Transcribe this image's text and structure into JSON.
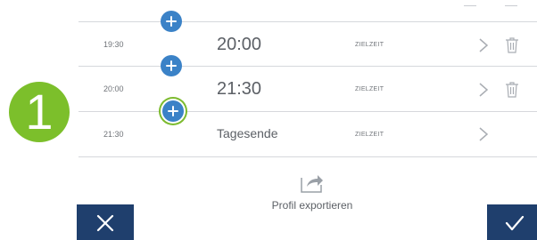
{
  "rows": [
    {
      "start": "19:30",
      "end": "20:00",
      "type": "ZIELZEIT"
    },
    {
      "start": "20:00",
      "end": "21:30",
      "type": "ZIELZEIT"
    },
    {
      "start": "21:30",
      "end": "Tagesende",
      "type": "ZIELZEIT"
    }
  ],
  "step_number": "1",
  "export_label": "Profil exportieren",
  "icons": {
    "add": "plus-icon",
    "chevron": "chevron-right-icon",
    "delete": "trash-icon",
    "export": "share-export-icon",
    "cancel": "close-icon",
    "confirm": "checkmark-icon"
  },
  "colors": {
    "accent_blue": "#3b82c7",
    "highlight_green": "#7cbf2b",
    "bar_navy": "#1f3f6d"
  }
}
